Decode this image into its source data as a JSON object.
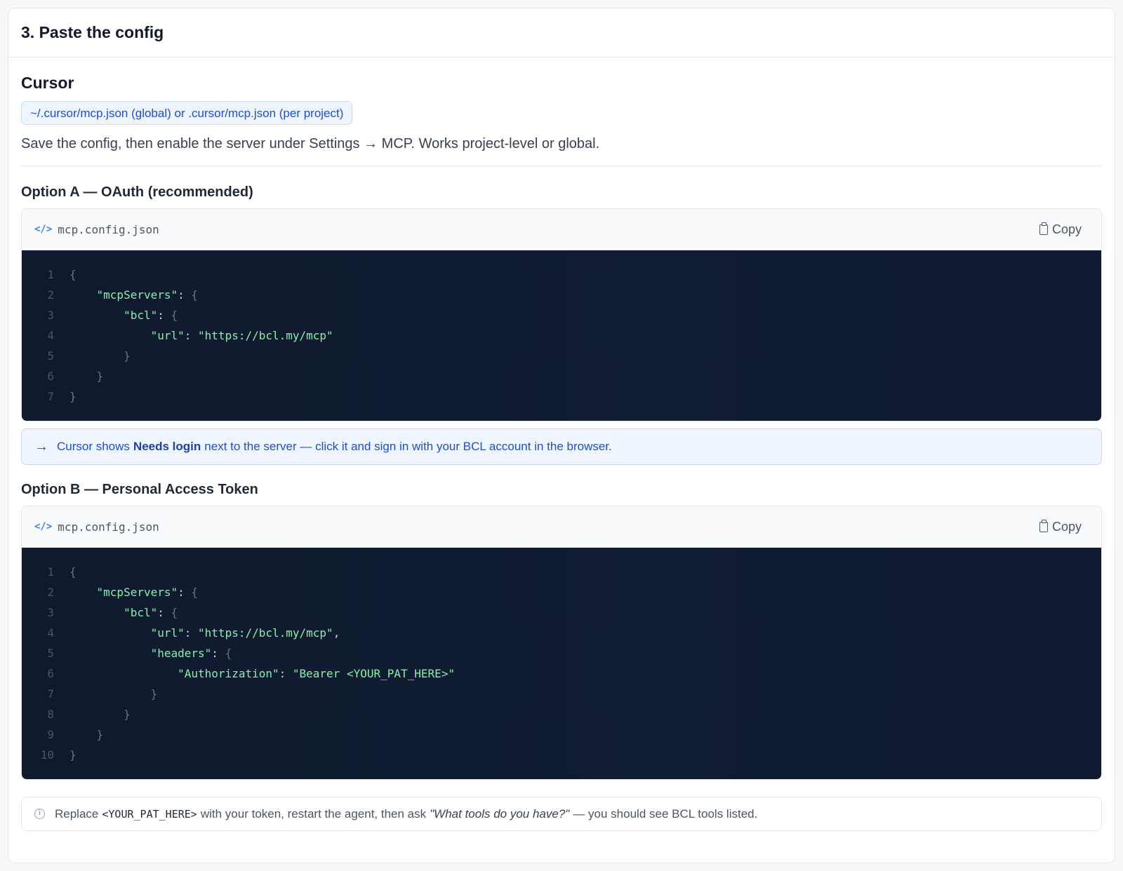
{
  "section": {
    "title": "3. Paste the config"
  },
  "client": {
    "name": "Cursor",
    "path": "~/.cursor/mcp.json (global) or .cursor/mcp.json (per project)",
    "description": "Save the config, then enable the server under Settings → MCP. Works project-level or global."
  },
  "option_a": {
    "title": "Option A — OAuth (recommended)",
    "filename": "mcp.config.json",
    "copy_label": "Copy",
    "lines": [
      {
        "n": "1",
        "code": "{"
      },
      {
        "n": "2",
        "code": "    \"mcpServers\": {"
      },
      {
        "n": "3",
        "code": "        \"bcl\": {"
      },
      {
        "n": "4",
        "code": "            \"url\": \"https://bcl.my/mcp\""
      },
      {
        "n": "5",
        "code": "        }"
      },
      {
        "n": "6",
        "code": "    }"
      },
      {
        "n": "7",
        "code": "}"
      }
    ],
    "callout": {
      "prefix": "Cursor shows",
      "bold": "Needs login",
      "suffix": "next to the server — click it and sign in with your BCL account in the browser."
    }
  },
  "option_b": {
    "title": "Option B — Personal Access Token",
    "filename": "mcp.config.json",
    "copy_label": "Copy",
    "lines": [
      {
        "n": "1",
        "code": "{"
      },
      {
        "n": "2",
        "code": "    \"mcpServers\": {"
      },
      {
        "n": "3",
        "code": "        \"bcl\": {"
      },
      {
        "n": "4",
        "code": "            \"url\": \"https://bcl.my/mcp\","
      },
      {
        "n": "5",
        "code": "            \"headers\": {"
      },
      {
        "n": "6",
        "code": "                \"Authorization\": \"Bearer <YOUR_PAT_HERE>\""
      },
      {
        "n": "7",
        "code": "            }"
      },
      {
        "n": "8",
        "code": "        }"
      },
      {
        "n": "9",
        "code": "    }"
      },
      {
        "n": "10",
        "code": "}"
      }
    ]
  },
  "note": {
    "prefix": "Replace",
    "code": "<YOUR_PAT_HERE>",
    "middle": "with your token, restart the agent, then ask",
    "quote": "\"What tools do you have?\"",
    "suffix": "— you should see BCL tools listed."
  },
  "icons": {
    "file": "code-icon",
    "copy": "clipboard-icon",
    "callout": "arrow-right-icon",
    "note": "info-icon"
  }
}
